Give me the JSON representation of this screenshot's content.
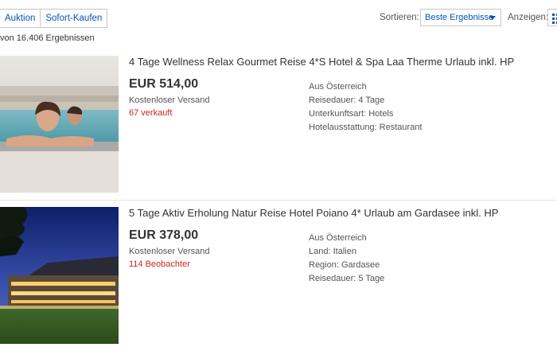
{
  "toolbar": {
    "tabs": [
      "Auktion",
      "Sofort-Kaufen"
    ],
    "sort_label": "Sortieren:",
    "sort_value": "Beste Ergebnisse",
    "view_label": "Anzeigen:"
  },
  "results_count": "von 16.406 Ergebnissen",
  "items": [
    {
      "title": "4 Tage Wellness Relax Gourmet Reise 4*S Hotel & Spa Laa Therme Urlaub inkl. HP",
      "price": "EUR 514,00",
      "shipping": "Kostenloser Versand",
      "status": "67 verkauft",
      "attributes": [
        "Aus Österreich",
        "Reisedauer: 4 Tage",
        "Unterkunftsart: Hotels",
        "Hotelausstattung: Restaurant"
      ]
    },
    {
      "title": "5 Tage Aktiv Erholung Natur Reise Hotel Poiano 4* Urlaub am Gardasee inkl. HP",
      "price": "EUR 378,00",
      "shipping": "Kostenloser Versand",
      "status": "114 Beobachter",
      "attributes": [
        "Aus Österreich",
        "Land: Italien",
        "Region: Gardasee",
        "Reisedauer: 5 Tage"
      ]
    }
  ],
  "colors": {
    "link": "#0654ba",
    "sold": "#c5281c",
    "text": "#333333"
  },
  "icons": [
    "grid-view-icon",
    "chevron-down-icon"
  ]
}
